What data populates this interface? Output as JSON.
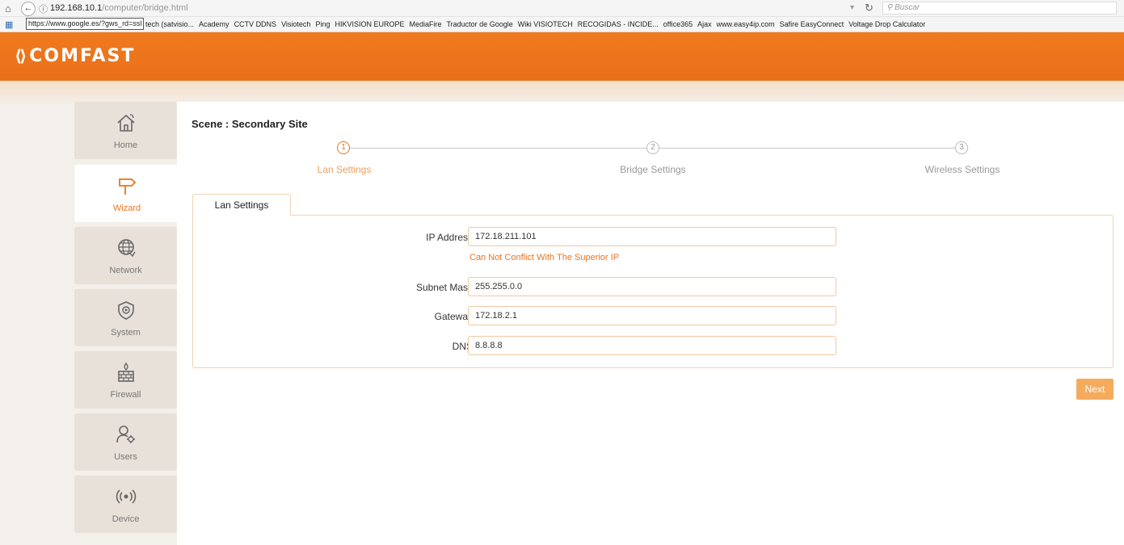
{
  "browser": {
    "url_host": "192.168.10.1",
    "url_path": "/computer/bridge.html",
    "search_placeholder": "Buscar",
    "tooltip": "https://www.google.es/?gws_rd=ssl",
    "bookmarks": [
      "tech (satvisio...",
      "Academy",
      "CCTV DDNS",
      "Visiotech",
      "Ping",
      "HIKVISION EUROPE",
      "MediaFire",
      "Traductor de Google",
      "Wiki VISIOTECH",
      "RECOGIDAS - INCIDE...",
      "office365",
      "Ajax",
      "www.easy4ip.com",
      "Safire EasyConnect",
      "Voltage Drop Calculator"
    ]
  },
  "header": {
    "logo_text": "COMFAST",
    "brand_color": "#ee761d"
  },
  "sidebar": {
    "items": [
      {
        "label": "Home",
        "icon": "home-icon"
      },
      {
        "label": "Wizard",
        "icon": "signpost-icon",
        "active": true
      },
      {
        "label": "Network",
        "icon": "globe-icon"
      },
      {
        "label": "System",
        "icon": "shield-icon"
      },
      {
        "label": "Firewall",
        "icon": "firewall-icon"
      },
      {
        "label": "Users",
        "icon": "users-icon"
      },
      {
        "label": "Device",
        "icon": "wireless-icon"
      }
    ]
  },
  "main": {
    "scene_title": "Scene : Secondary Site",
    "steps": [
      {
        "number": "1",
        "label": "Lan Settings",
        "active": true
      },
      {
        "number": "2",
        "label": "Bridge Settings",
        "active": false
      },
      {
        "number": "3",
        "label": "Wireless Settings",
        "active": false
      }
    ],
    "tab_label": "Lan Settings",
    "form": {
      "ip_label": "IP Address",
      "ip_value": "172.18.211.101",
      "ip_hint": "Can Not Conflict With The Superior IP",
      "mask_label": "Subnet Mask",
      "mask_value": "255.255.0.0",
      "gateway_label": "Gateway",
      "gateway_value": "172.18.2.1",
      "dns_label": "DNS",
      "dns_value": "8.8.8.8"
    },
    "next_label": "Next"
  }
}
